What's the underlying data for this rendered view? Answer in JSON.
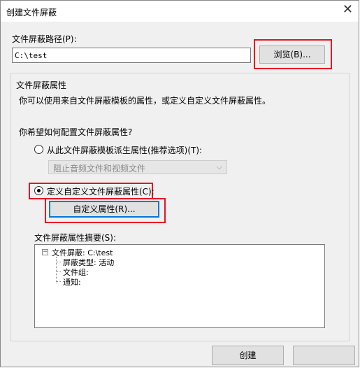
{
  "window": {
    "title": "创建文件屏蔽"
  },
  "path": {
    "label": "文件屏蔽路径(P):",
    "value": "C:\\test",
    "browse_label": "浏览(B)..."
  },
  "properties": {
    "heading": "文件屏蔽属性",
    "description": "你可以使用来自文件屏蔽模板的属性，或定义自定义文件屏蔽属性。",
    "question": "你希望如何配置文件屏蔽属性?",
    "option_template": "从此文件屏蔽模板派生属性(推荐选项)(T):",
    "template_select_value": "阻止音频文件和视频文件",
    "option_custom": "定义自定义文件屏蔽属性(C):",
    "custom_button_label": "自定义属性(R)...",
    "selected_option": "custom"
  },
  "summary": {
    "label": "文件屏蔽属性摘要(S):",
    "root": "文件屏蔽: C:\\test",
    "expander": "−",
    "items": [
      "屏蔽类型: 活动",
      "文件组:",
      "通知:"
    ]
  },
  "footer": {
    "create_label": "创建"
  },
  "colors": {
    "accent": "#0078d7",
    "highlight_red": "#e81123"
  }
}
